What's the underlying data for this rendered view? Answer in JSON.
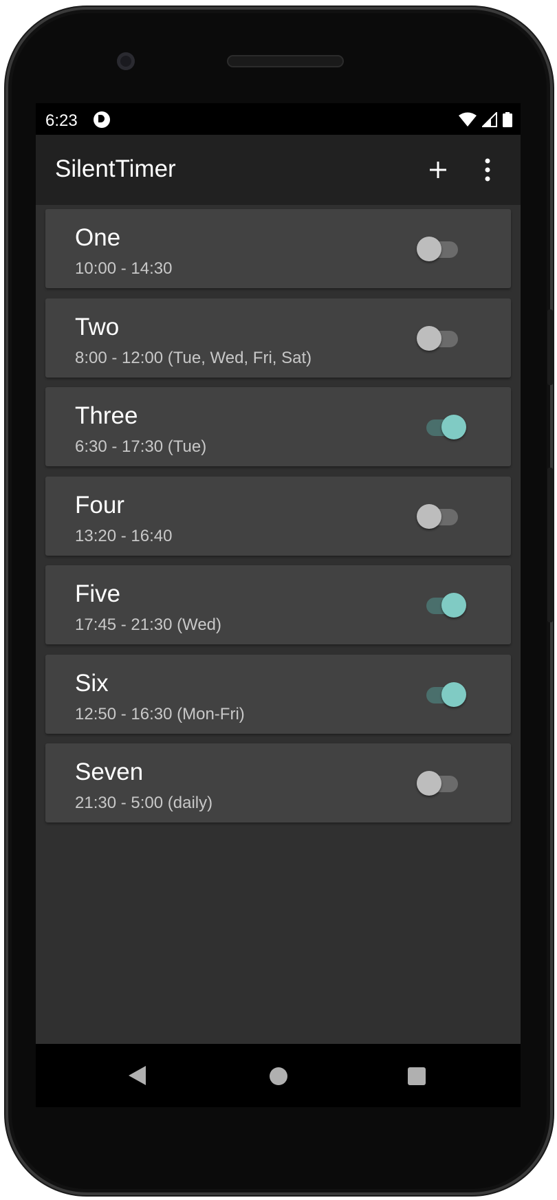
{
  "status_bar": {
    "time": "6:23",
    "icons": [
      "app-notification-icon",
      "wifi-icon",
      "signal-icon",
      "battery-icon"
    ]
  },
  "app_bar": {
    "title": "SilentTimer",
    "actions": [
      "add-icon",
      "more-vert-icon"
    ]
  },
  "colors": {
    "screen_bg": "#303030",
    "card_bg": "#424242",
    "appbar_bg": "#212121",
    "switch_on": "#80cbc4",
    "switch_off": "#bdbdbd"
  },
  "timers": [
    {
      "name": "One",
      "schedule": "10:00 - 14:30",
      "enabled": false
    },
    {
      "name": "Two",
      "schedule": "8:00 - 12:00 (Tue, Wed, Fri, Sat)",
      "enabled": false
    },
    {
      "name": "Three",
      "schedule": "6:30 - 17:30 (Tue)",
      "enabled": true
    },
    {
      "name": "Four",
      "schedule": "13:20 - 16:40",
      "enabled": false
    },
    {
      "name": "Five",
      "schedule": "17:45 - 21:30 (Wed)",
      "enabled": true
    },
    {
      "name": "Six",
      "schedule": "12:50 - 16:30 (Mon-Fri)",
      "enabled": true
    },
    {
      "name": "Seven",
      "schedule": "21:30 - 5:00 (daily)",
      "enabled": false
    }
  ],
  "nav_bar": [
    "back-icon",
    "home-icon",
    "recents-icon"
  ]
}
